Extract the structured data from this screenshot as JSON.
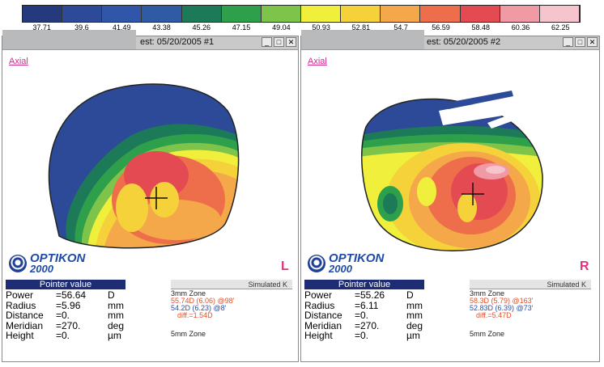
{
  "scale": {
    "colors": [
      "#243a7c",
      "#2d4a98",
      "#2f56a8",
      "#2f5aa4",
      "#1d7a58",
      "#2ea04c",
      "#7ec44a",
      "#f0f03c",
      "#f6d23a",
      "#f4a84a",
      "#ee6e4c",
      "#e34a52",
      "#f09aa6",
      "#f6c4cc"
    ],
    "labels": [
      "37.71",
      "39.6",
      "41.49",
      "43.38",
      "45.26",
      "47.15",
      "49.04",
      "50.93",
      "52.81",
      "54.7",
      "56.59",
      "58.48",
      "60.36",
      "62.25"
    ]
  },
  "left": {
    "title": "est: 05/20/2005 #1",
    "axial": "Axial",
    "logo_line1": "OPTIKON",
    "logo_line2": "2000",
    "eye": "L",
    "pointer_header": "Pointer value",
    "rows": [
      {
        "label": "Power",
        "value": "=56.64",
        "unit": "D"
      },
      {
        "label": "Radius",
        "value": "=5.96",
        "unit": "mm"
      },
      {
        "label": "Distance",
        "value": "=0.",
        "unit": "mm"
      },
      {
        "label": "Meridian",
        "value": "=270.",
        "unit": "deg"
      },
      {
        "label": "Height",
        "value": "=0.",
        "unit": "µm"
      }
    ],
    "simk_header": "Simulated K",
    "zone3": "3mm Zone",
    "k1": "55.74D (6.06) @98'",
    "k2": "54.2D (6.23) @8'",
    "diff": "diff.=1.54D",
    "zone5": "5mm Zone"
  },
  "right": {
    "title": "est: 05/20/2005 #2",
    "axial": "Axial",
    "logo_line1": "OPTIKON",
    "logo_line2": "2000",
    "eye": "R",
    "pointer_header": "Pointer value",
    "rows": [
      {
        "label": "Power",
        "value": "=55.26",
        "unit": "D"
      },
      {
        "label": "Radius",
        "value": "=6.11",
        "unit": "mm"
      },
      {
        "label": "Distance",
        "value": "=0.",
        "unit": "mm"
      },
      {
        "label": "Meridian",
        "value": "=270.",
        "unit": "deg"
      },
      {
        "label": "Height",
        "value": "=0.",
        "unit": "µm"
      }
    ],
    "simk_header": "Simulated K",
    "zone3": "3mm Zone",
    "k1": "58.3D (5.79) @163'",
    "k2": "52.83D (6.39) @73'",
    "diff": "diff.=5.47D",
    "zone5": "5mm Zone"
  },
  "window_buttons": {
    "minimize": "_",
    "maximize": "□",
    "close": "✕"
  }
}
